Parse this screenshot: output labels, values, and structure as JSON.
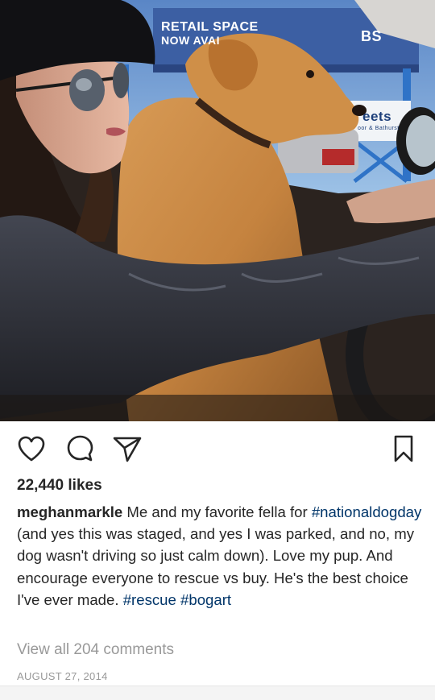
{
  "photo": {
    "sign_line1": "RETAIL SPACE",
    "sign_line2": "NOW AVAI",
    "sign_right": "BS",
    "store_sign": "eets",
    "street_sign": "oor & Bathurst"
  },
  "actions": {
    "like_icon": "heart-icon",
    "comment_icon": "comment-icon",
    "share_icon": "send-icon",
    "save_icon": "bookmark-icon"
  },
  "likes": "22,440 likes",
  "caption": {
    "username": "meghanmarkle",
    "text_part1": " Me and my favorite fella for ",
    "hashtag1": "#nationaldogday",
    "text_part2": " (and yes this was staged, and yes I was parked, and no, my dog wasn't driving so just calm down). Love my pup. And encourage everyone to rescue vs buy. He's the best choice I've ever made. ",
    "hashtag2": "#rescue",
    "hashtag3": "#bogart"
  },
  "comments_link": "View all 204 comments",
  "date": "AUGUST 27, 2014",
  "colors": {
    "text": "#262626",
    "muted": "#999999",
    "hashtag": "#003569"
  }
}
